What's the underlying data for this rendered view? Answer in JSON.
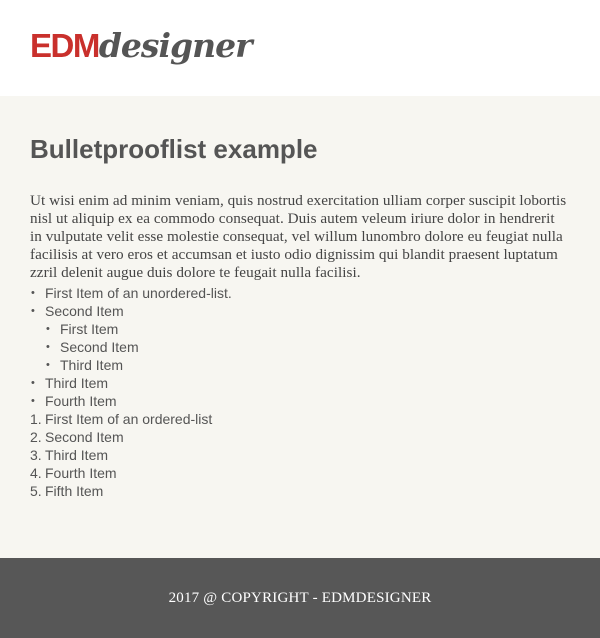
{
  "logo": {
    "part1": "EDM",
    "part2": "designer"
  },
  "colors": {
    "accent": "#c9302c",
    "text": "#555555",
    "content_bg": "#f7f6f1",
    "footer_bg": "#575757"
  },
  "content": {
    "title": "Bulletprooflist example",
    "paragraph": "Ut wisi enim ad minim veniam, quis nostrud exercitation ulliam corper suscipit lobortis nisl ut aliquip ex ea commodo consequat. Duis autem veleum iriure dolor in hendrerit in vulputate velit esse molestie consequat, vel willum lunombro dolore eu feugiat nulla facilisis at vero eros et accumsan et iusto odio dignissim qui blandit praesent luptatum zzril delenit augue duis dolore te feugait nulla facilisi.",
    "unordered": {
      "bullet": "•",
      "items": [
        "First Item of an unordered-list.",
        "Second Item",
        "Third Item",
        "Fourth Item"
      ],
      "subitems": [
        "First Item",
        "Second Item",
        "Third Item"
      ]
    },
    "ordered": {
      "markers": [
        "1.",
        "2.",
        "3.",
        "4.",
        "5."
      ],
      "items": [
        "First Item of an ordered-list",
        "Second Item",
        "Third Item",
        "Fourth Item",
        "Fifth Item"
      ]
    }
  },
  "footer": {
    "copyright": "2017 @ COPYRIGHT - EDMDESIGNER"
  }
}
